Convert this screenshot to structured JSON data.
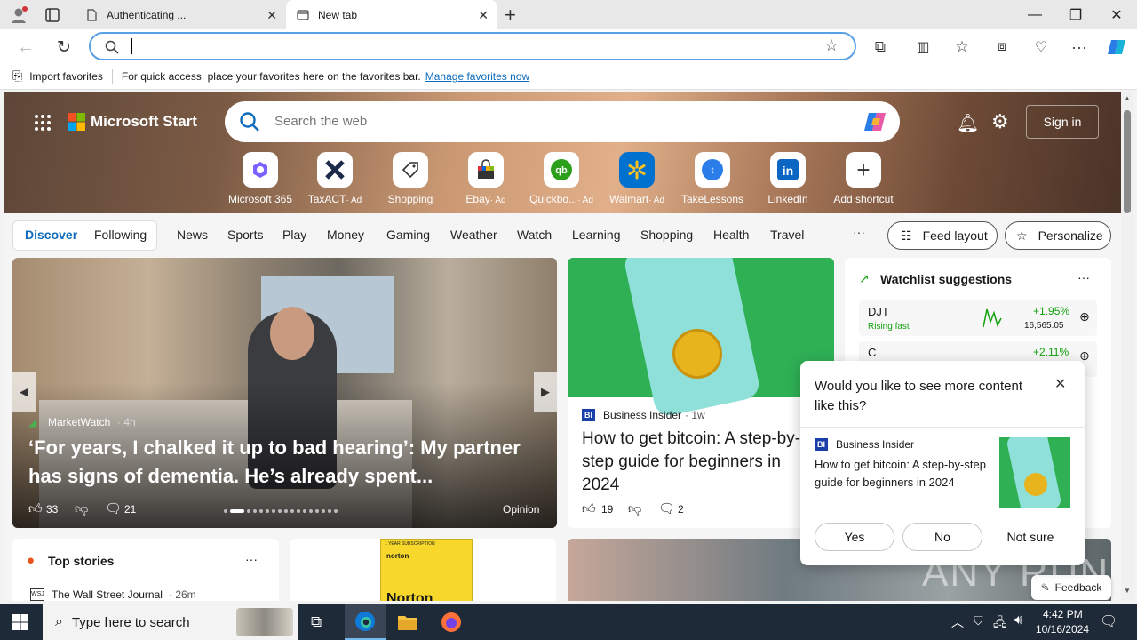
{
  "browser": {
    "tabs": [
      {
        "title": "Authenticating ..."
      },
      {
        "title": "New tab"
      }
    ],
    "address_value": "",
    "favorites_bar": {
      "import_label": "Import favorites",
      "message": "For quick access, place your favorites here on the favorites bar.",
      "manage_link": "Manage favorites now"
    }
  },
  "page": {
    "brand": "Microsoft Start",
    "search_placeholder": "Search the web",
    "sign_in": "Sign in",
    "shortcuts": [
      {
        "label": "Microsoft 365",
        "ad": ""
      },
      {
        "label": "TaxACT",
        "ad": "· Ad"
      },
      {
        "label": "Shopping",
        "ad": ""
      },
      {
        "label": "Ebay",
        "ad": "· Ad"
      },
      {
        "label": "Quickbo...",
        "ad": "· Ad"
      },
      {
        "label": "Walmart",
        "ad": "· Ad"
      },
      {
        "label": "TakeLessons",
        "ad": ""
      },
      {
        "label": "LinkedIn",
        "ad": ""
      },
      {
        "label": "Add shortcut",
        "ad": ""
      }
    ],
    "nav": {
      "discover": "Discover",
      "following": "Following",
      "items": [
        "News",
        "Sports",
        "Play",
        "Money",
        "Gaming",
        "Weather",
        "Watch",
        "Learning",
        "Shopping",
        "Health",
        "Travel"
      ],
      "more": "···",
      "feed_layout": "Feed layout",
      "personalize": "Personalize"
    },
    "main_story": {
      "source": "MarketWatch",
      "age": "· 4h",
      "headline": "‘For years, I chalked it up to bad hearing’: My partner has signs of dementia. He’s already spent...",
      "likes": "33",
      "comments": "21",
      "tag": "Opinion"
    },
    "second_story": {
      "source": "Business Insider",
      "age": "· 1w",
      "headline": "How to get bitcoin: A step-by-step guide for beginners in 2024",
      "likes": "19",
      "comments": "2"
    },
    "watchlist": {
      "title": "Watchlist suggestions",
      "more": "···",
      "items": [
        {
          "symbol": "DJT",
          "note": "Rising fast",
          "change": "+1.95%",
          "price": "16,565.05"
        },
        {
          "symbol": "C",
          "note": "",
          "change": "+2.11%",
          "price": ""
        }
      ]
    },
    "top_stories": {
      "title": "Top stories",
      "more": "···",
      "first_source": "The Wall Street Journal",
      "first_age": "· 26m"
    },
    "ad_box": {
      "top": "1 YEAR SUBSCRIPTION",
      "brand": "norton",
      "product": "Norton"
    },
    "feedback": "Feedback",
    "watermark": "ANY RUN"
  },
  "popup": {
    "question": "Would you like to see more content like this?",
    "source": "Business Insider",
    "headline": "How to get bitcoin: A step-by-step guide for beginners in 2024",
    "yes": "Yes",
    "no": "No",
    "not_sure": "Not sure"
  },
  "taskbar": {
    "search_placeholder": "Type here to search",
    "time": "4:42 PM",
    "date": "10/16/2024"
  },
  "colors": {
    "accent": "#0f6cbd",
    "taskbar": "#1f2a38",
    "green": "#13a10e"
  }
}
